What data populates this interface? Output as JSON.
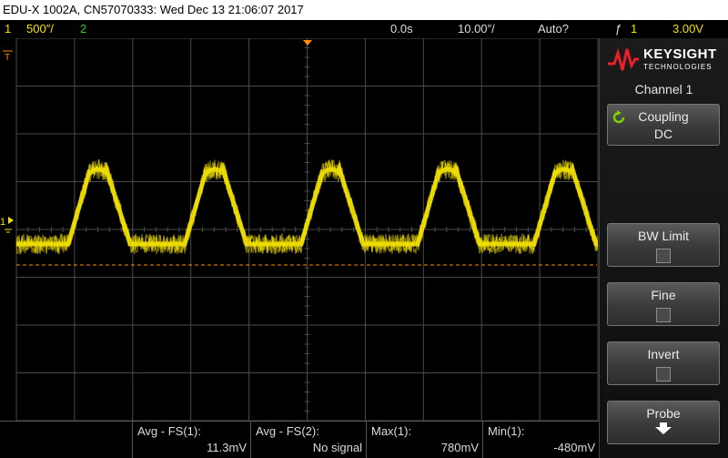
{
  "title_bar": {
    "text": "EDU-X 1002A, CN57070333: Wed Dec 13 21:06:07 2017"
  },
  "status_bar": {
    "ch1_number": "1",
    "ch1_scale": "500″/",
    "ch2_number": "2",
    "time_delay": "0.0s",
    "time_scale": "10.00″/",
    "trigger_mode": "Auto?",
    "trigger_symbol": "ƒ",
    "trigger_source": "1",
    "trigger_level": "3.00V"
  },
  "screen": {
    "ch1_marker": "1",
    "trigger_marker": "T",
    "colors": {
      "ch1": "#f2e000",
      "ch2": "#2fd12f",
      "grid": "#4a4a4a",
      "trigger_line": "#ff8c00"
    }
  },
  "panel": {
    "brand": "KEYSIGHT",
    "brand_sub": "TECHNOLOGIES",
    "title": "Channel 1",
    "coupling": {
      "label": "Coupling",
      "value": "DC"
    },
    "bw_limit": {
      "label": "BW Limit"
    },
    "fine": {
      "label": "Fine"
    },
    "invert": {
      "label": "Invert"
    },
    "probe": {
      "label": "Probe"
    }
  },
  "measurements": [
    {
      "name": "Avg - FS(1):",
      "value": "11.3mV"
    },
    {
      "name": "Avg - FS(2):",
      "value": "No signal"
    },
    {
      "name": "Max(1):",
      "value": "780mV"
    },
    {
      "name": "Min(1):",
      "value": "-480mV"
    }
  ]
}
